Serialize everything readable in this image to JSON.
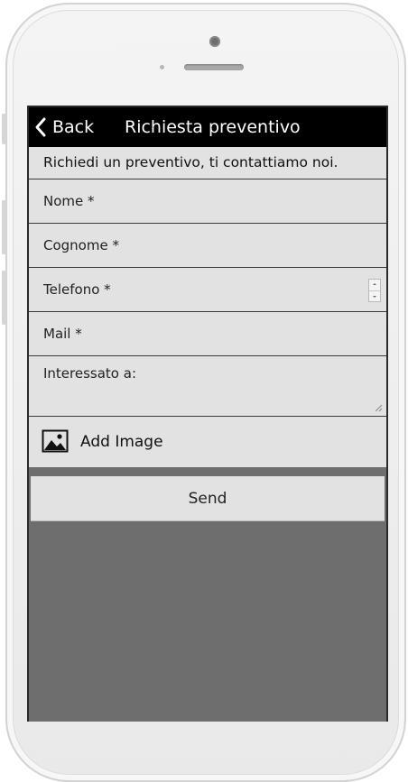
{
  "navbar": {
    "back_label": "Back",
    "title": "Richiesta preventivo",
    "back_icon": "chevron-left-icon"
  },
  "intro_text": "Richiedi un preventivo, ti contattiamo noi.",
  "form": {
    "nome_placeholder": "Nome *",
    "cognome_placeholder": "Cognome *",
    "telefono_placeholder": "Telefono *",
    "mail_placeholder": "Mail *",
    "interessato_placeholder": "Interessato a:",
    "add_image_label": "Add Image",
    "add_image_icon": "image-icon",
    "send_label": "Send"
  },
  "colors": {
    "navbar_bg": "#000000",
    "field_bg": "#e2e2e2",
    "screen_bg": "#6e6e6e"
  }
}
